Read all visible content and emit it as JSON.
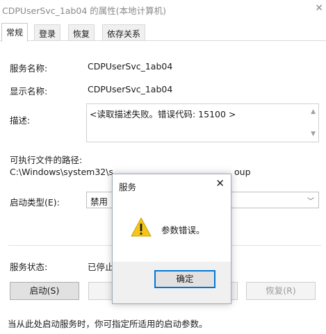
{
  "window": {
    "title": "CDPUserSvc_1ab04 的属性(本地计算机)",
    "close_glyph": "✕"
  },
  "tabs": [
    {
      "label": "常规"
    },
    {
      "label": "登录"
    },
    {
      "label": "恢复"
    },
    {
      "label": "依存关系"
    }
  ],
  "general": {
    "service_name_label": "服务名称:",
    "service_name_value": "CDPUserSvc_1ab04",
    "display_name_label": "显示名称:",
    "display_name_value": "CDPUserSvc_1ab04",
    "description_label": "描述:",
    "description_value": "<读取描述失败。错误代码: 15100 >",
    "exe_path_label": "可执行文件的路径:",
    "exe_path_value": "C:\\Windows\\system32\\s",
    "exe_path_tail": "oup",
    "startup_type_label": "启动类型(E):",
    "startup_type_value": "禁用",
    "service_status_label": "服务状态:",
    "service_status_value": "已停止",
    "start_button": "启动(S)",
    "resume_button": "恢复(R)",
    "hint": "当从此处启动服务时，你可指定所适用的启动参数。"
  },
  "dialog": {
    "title": "服务",
    "message": "参数错误。",
    "ok_button": "确定",
    "close_glyph": "✕",
    "icon": "warning-icon"
  },
  "colors": {
    "accent": "#0078d7",
    "warning": "#f5c518"
  }
}
